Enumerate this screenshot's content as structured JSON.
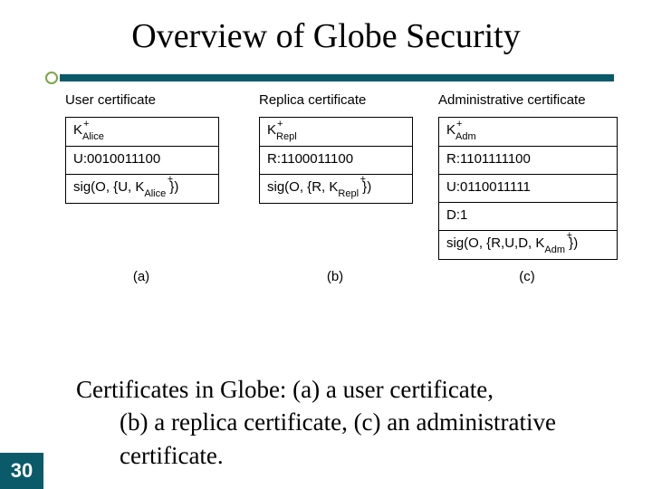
{
  "title": "Overview of Globe Security",
  "page_number": "30",
  "columns": {
    "a": {
      "header": "User certificate",
      "label": "(a)",
      "key_sub": "Alice",
      "rows": {
        "bits_prefix": "U:",
        "bits": "0010011100",
        "sig_inner": "U",
        "sig_sub": "Alice"
      }
    },
    "b": {
      "header": "Replica certificate",
      "label": "(b)",
      "key_sub": "Repl",
      "rows": {
        "bits_prefix": "R:",
        "bits": "1100011100",
        "sig_inner": "R",
        "sig_sub": "Repl"
      }
    },
    "c": {
      "header": "Administrative certificate",
      "label": "(c)",
      "key_sub": "Adm",
      "rows": {
        "r_prefix": "R:",
        "r_bits": "1101111100",
        "u_prefix": "U:",
        "u_bits": "0110011111",
        "d_prefix": "D:",
        "d_val": "1",
        "sig_inner": "R,U,D",
        "sig_sub": "Adm"
      }
    }
  },
  "caption": {
    "line1": "Certificates in Globe: (a) a user certificate,",
    "line2": "(b) a replica certificate, (c) an administrative",
    "line3": "certificate."
  }
}
